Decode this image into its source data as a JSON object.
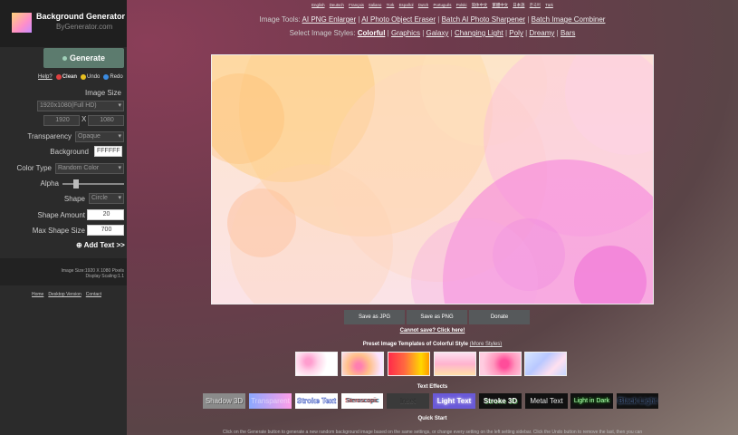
{
  "sidebar": {
    "brand_title": "Background Generator",
    "brand_sub": "ByGenerator.com",
    "generate_label": "Generate",
    "help": "Help?",
    "clean": "Clean",
    "undo": "Undo",
    "redo": "Redo",
    "image_size_label": "Image Size",
    "image_size_value": "1920x1080(Full HD)",
    "width": "1920",
    "x_sep": "X",
    "height": "1080",
    "transparency_label": "Transparency",
    "transparency_value": "Opaque",
    "background_label": "Background",
    "background_value": "FFFFFF",
    "color_type_label": "Color Type",
    "color_type_value": "Random Color",
    "alpha_label": "Alpha",
    "alpha_fraction": 0.2,
    "shape_label": "Shape",
    "shape_value": "Circle",
    "shape_amount_label": "Shape Amount",
    "shape_amount_value": "20",
    "max_shape_size_label": "Max Shape Size",
    "max_shape_size_value": "700",
    "add_text": "Add Text >>",
    "info_line1": "Image Size:1920 X 1080 Pixels",
    "info_line2": "Display Scaling:1.1",
    "footer": [
      "Home",
      "Desktop Version",
      "Contact"
    ]
  },
  "languages": [
    "English",
    "Deutsch",
    "Français",
    "Italiano",
    "Türk",
    "Español",
    "Dutch",
    "Português",
    "Polski",
    "简体中文",
    "繁體中文",
    "日本語",
    "한국어",
    "Türk"
  ],
  "tools": {
    "prefix": "Image Tools:",
    "links": [
      "AI PNG Enlarger",
      "AI Photo Object Eraser",
      "Batch AI Photo Sharpener",
      "Batch Image Combiner"
    ]
  },
  "styles": {
    "prefix": "Select Image Styles:",
    "links": [
      "Colorful",
      "Graphics",
      "Galaxy",
      "Changing Light",
      "Poly",
      "Dreamy",
      "Bars"
    ]
  },
  "save": {
    "jpg": "Save as JPG",
    "png": "Save as PNG",
    "donate": "Donate",
    "cannot": "Cannot save? Click here!"
  },
  "presets": {
    "heading": "Preset Image Templates of Colorful Style",
    "more": "(More Styles)"
  },
  "effects": {
    "heading": "Text Effects",
    "items": [
      "Shadow 3D",
      "Transparent",
      "Stroke Text",
      "Steroscopic",
      "Inset",
      "Light Text",
      "Stroke 3D",
      "Metal Text",
      "Light in Dark",
      "Black Light"
    ]
  },
  "quick_start": {
    "heading": "Quick Start",
    "text": "Click on the Generate button to generate a new random background image based on the same settings, or change every setting on the left setting sidebar. Click the Undo button to remove the last, then you can"
  },
  "colors": {
    "sidebar_bg": "#2b2b2b",
    "generate_btn": "#5c7b6e",
    "clean_dot": "#e04040",
    "undo_dot": "#e8c020",
    "redo_dot": "#3a8ae0"
  }
}
